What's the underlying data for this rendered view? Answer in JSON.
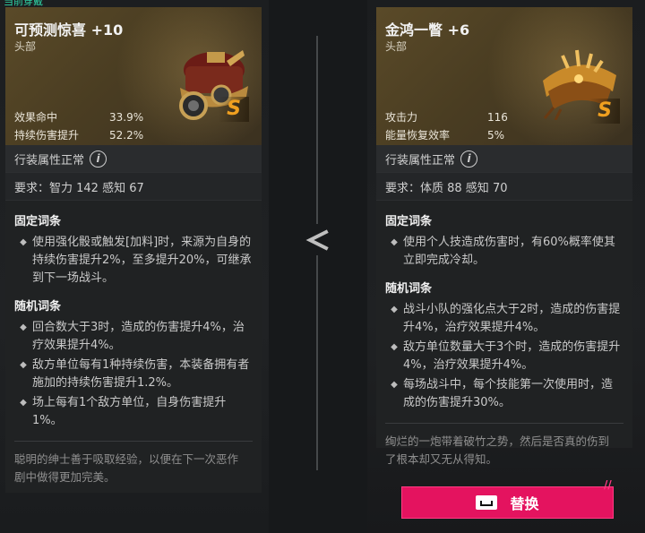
{
  "top_tag": "当前穿戴",
  "compare_arrow": "<",
  "left": {
    "name": "可预测惊喜 +10",
    "slot": "头部",
    "grade": "S",
    "stats": [
      {
        "label": "效果命中",
        "value": "33.9%"
      },
      {
        "label": "持续伤害提升",
        "value": "52.2%"
      }
    ],
    "attr_status": "行装属性正常",
    "requirement": "要求：智力 142 感知 67",
    "fixed_title": "固定词条",
    "fixed": [
      "使用强化骰或触发[加料]时，来源为自身的持续伤害提升2%，至多提升20%，可继承到下一场战斗。"
    ],
    "random_title": "随机词条",
    "random": [
      "回合数大于3时，造成的伤害提升4%，治疗效果提升4%。",
      "敌方单位每有1种持续伤害，本装备拥有者施加的持续伤害提升1.2%。",
      "场上每有1个敌方单位，自身伤害提升1%。"
    ],
    "flavor": "聪明的绅士善于吸取经验，以便在下一次恶作剧中做得更加完美。"
  },
  "right": {
    "name": "金鸿一瞥  +6",
    "slot": "头部",
    "grade": "S",
    "stats": [
      {
        "label": "攻击力",
        "value": "116"
      },
      {
        "label": "能量恢复效率",
        "value": "5%"
      }
    ],
    "attr_status": "行装属性正常",
    "requirement": "要求：体质 88 感知 70",
    "fixed_title": "固定词条",
    "fixed": [
      "使用个人技造成伤害时，有60%概率使其立即完成冷却。"
    ],
    "random_title": "随机词条",
    "random": [
      "战斗小队的强化点大于2时，造成的伤害提升4%，治疗效果提升4%。",
      "敌方单位数量大于3个时，造成的伤害提升4%，治疗效果提升4%。",
      "每场战斗中，每个技能第一次使用时，造成的伤害提升30%。"
    ],
    "flavor": "绚烂的一炮带着破竹之势，然后是否真的伤到了根本却又无从得知。"
  },
  "replace_button": "替换",
  "button_mark": "//",
  "colors": {
    "accent": "#e4135f",
    "grade": "#f0a020",
    "header_gold": "#5a4a28"
  }
}
